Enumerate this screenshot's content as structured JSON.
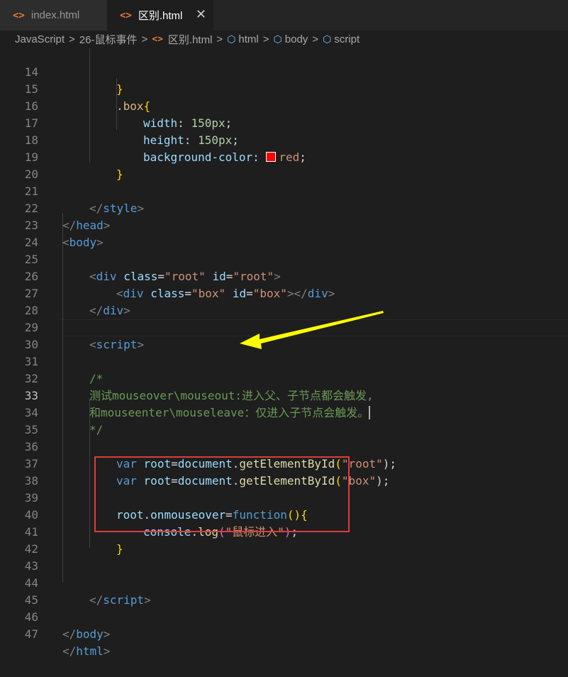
{
  "tabs": [
    {
      "label": "index.html",
      "icon": "html-file-icon",
      "active": false
    },
    {
      "label": "区别.html",
      "icon": "html-file-icon",
      "active": true,
      "close": "✕"
    }
  ],
  "breadcrumb": {
    "items": [
      "JavaScript",
      "26-鼠标事件",
      "区别.html",
      "html",
      "body",
      "script"
    ],
    "separator": ">"
  },
  "editor": {
    "current_line": 33,
    "line_numbers": [
      "14",
      "15",
      "16",
      "17",
      "18",
      "19",
      "20",
      "21",
      "22",
      "23",
      "24",
      "25",
      "26",
      "27",
      "28",
      "29",
      "30",
      "31",
      "32",
      "33",
      "34",
      "35",
      "36",
      "37",
      "38",
      "39",
      "40",
      "41",
      "42",
      "43",
      "44",
      "45",
      "46",
      "47"
    ],
    "lines": {
      "l14": [
        "}"
      ],
      "l15": [
        ".box",
        "{"
      ],
      "l16": [
        "width",
        ": ",
        "150px",
        ";"
      ],
      "l17": [
        "height",
        ": ",
        "150px",
        ";"
      ],
      "l18": [
        "background-color",
        ": ",
        "red",
        ";"
      ],
      "l19": [
        "}"
      ],
      "l21": [
        "</",
        "style",
        ">"
      ],
      "l22": [
        "</",
        "head",
        ">"
      ],
      "l23": [
        "<",
        "body",
        ">"
      ],
      "l25": [
        "<",
        "div",
        " ",
        "class",
        "=",
        "\"root\"",
        " ",
        "id",
        "=",
        "\"root\"",
        ">"
      ],
      "l26": [
        "<",
        "div",
        " ",
        "class",
        "=",
        "\"box\"",
        " ",
        "id",
        "=",
        "\"box\"",
        "></",
        "div",
        ">"
      ],
      "l27": [
        "</",
        "div",
        ">"
      ],
      "l29": [
        "<",
        "script",
        ">"
      ],
      "l31": [
        "/*"
      ],
      "l32": [
        "测试mouseover\\mouseout:进入父、子节点都会触发,"
      ],
      "l33": [
        "和mouseenter\\mouseleave：仅进入子节点会触发。"
      ],
      "l34": [
        "*/"
      ],
      "l36": [
        "var",
        " ",
        "root",
        "=",
        "document",
        ".",
        "getElementById",
        "(",
        "\"root\"",
        ");"
      ],
      "l37": [
        "var",
        " ",
        "root",
        "=",
        "document",
        ".",
        "getElementById",
        "(",
        "\"box\"",
        ");"
      ],
      "l39": [
        "root",
        ".",
        "onmouseover",
        "=",
        "function",
        "(",
        ")",
        "{"
      ],
      "l40": [
        "console",
        ".",
        "log",
        "(",
        "\"鼠标进入\"",
        ")",
        ";"
      ],
      "l41": [
        "}"
      ],
      "l44": [
        "</",
        "script",
        ">"
      ],
      "l46": [
        "</",
        "body",
        ">"
      ],
      "l47": [
        "</",
        "html",
        ">"
      ]
    }
  },
  "colors": {
    "editor_background": "#1e1e1e",
    "annotation_box": "#e03c3c",
    "annotation_arrow": "#ffff00",
    "swatch_red": "#ff0000"
  }
}
